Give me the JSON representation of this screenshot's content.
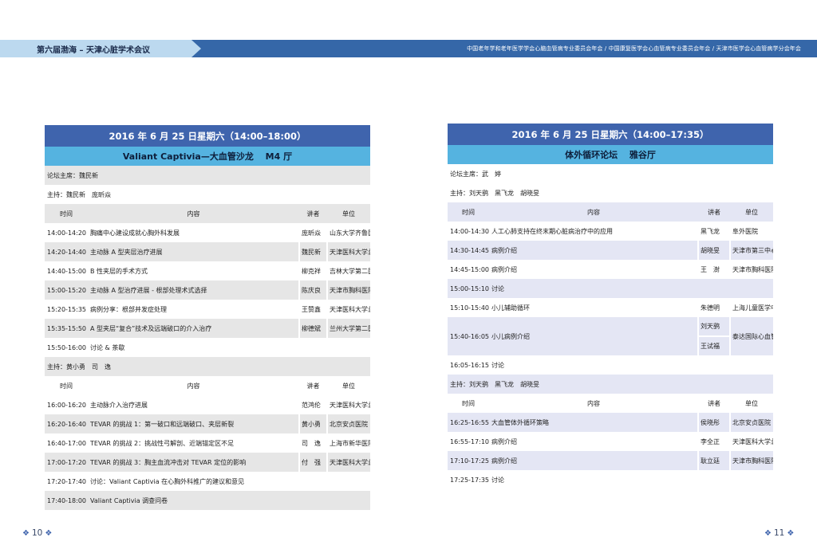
{
  "header": {
    "left_title": "第六届渤海 – 天津心脏学术会议",
    "right_text": "中国老年学和老年医学学会心脑血管病专业委员会年会 / 中国康复医学会心血管病专业委员会年会 / 天津市医学会心血管病学分会年会"
  },
  "left": {
    "date": "2016 年 6 月 25 日星期六（14:00–18:00）",
    "venue": "Valiant Captivia—大血管沙龙 　M4 厅",
    "forum_chair": "论坛主席：魏民新",
    "chair1": "主持：魏民新　庞昕焱",
    "columns": [
      "时间",
      "内容",
      "讲者",
      "单位"
    ],
    "rows1": [
      {
        "time": "14:00-14:20",
        "content": "胸痛中心建设成就心胸外科发展",
        "speaker": "庞昕焱",
        "unit": "山东大学齐鲁医院"
      },
      {
        "time": "14:20-14:40",
        "content": "主动脉 A 型夹层治疗进展",
        "speaker": "魏民新",
        "unit": "天津医科大学总医院"
      },
      {
        "time": "14:40-15:00",
        "content": "B 性夹层的手术方式",
        "speaker": "柳克祥",
        "unit": "吉林大学第二医院"
      },
      {
        "time": "15:00-15:20",
        "content": "主动脉 A 型治疗进展 - 根部处理术式选择",
        "speaker": "陈庆良",
        "unit": "天津市胸科医院"
      },
      {
        "time": "15:20-15:35",
        "content": "病例分享：根部并发症处理",
        "speaker": "王赞鑫",
        "unit": "天津医科大学总医院"
      },
      {
        "time": "15:35-15:50",
        "content": "A 型夹层“复合”技术及远端破口的介入治疗",
        "speaker": "柳德斌",
        "unit": "兰州大学第二医院"
      },
      {
        "time": "15:50-16:00",
        "content": "讨论 & 茶歇",
        "speaker": "",
        "unit": ""
      }
    ],
    "chair2": "主持：黄小勇　司　逸",
    "rows2": [
      {
        "time": "16:00-16:20",
        "content": "主动脉介入治疗进展",
        "speaker": "范鸿伦",
        "unit": "天津医科大学总医院"
      },
      {
        "time": "16:20-16:40",
        "content": "TEVAR 的挑战 1：第一破口和远端破口、夹层新裂",
        "speaker": "黄小勇",
        "unit": "北京安贞医院"
      },
      {
        "time": "16:40-17:00",
        "content": "TEVAR 的挑战 2：挑战性弓解剖、近端锚定区不足",
        "speaker": "司　逸",
        "unit": "上海市新华医院"
      },
      {
        "time": "17:00-17:20",
        "content": "TEVAR 的挑战 3：胸主血流冲击对 TEVAR 定位的影响",
        "speaker": "付　强",
        "unit": "天津医科大学总医院"
      },
      {
        "time": "17:20-17:40",
        "content": "讨论：Valiant Captivia 在心胸外科推广的建议和意见",
        "speaker": "",
        "unit": ""
      },
      {
        "time": "17:40-18:00",
        "content": "Valiant Captivia 调查问卷",
        "speaker": "",
        "unit": ""
      }
    ]
  },
  "right": {
    "date": "2016 年 6 月 25 日星期六（14:00–17:35）",
    "venue": "体外循环论坛 　雅谷厅",
    "forum_chair": "论坛主席：武　婷",
    "chair1": "主持：刘天鹞　黑飞龙　胡晓旻",
    "columns": [
      "时间",
      "内容",
      "讲者",
      "单位"
    ],
    "rows1": [
      {
        "time": "14:00-14:30",
        "content": "人工心肺支持在终末期心脏病治疗中的应用",
        "speaker": "黑飞龙",
        "unit": "阜外医院"
      },
      {
        "time": "14:30-14:45",
        "content": "病例介绍",
        "speaker": "胡晓旻",
        "unit": "天津市第三中心医院"
      },
      {
        "time": "14:45-15:00",
        "content": "病例介绍",
        "speaker": "王　澍",
        "unit": "天津市胸科医院"
      },
      {
        "time": "15:00-15:10",
        "content": "讨论",
        "speaker": "",
        "unit": ""
      },
      {
        "time": "15:10-15:40",
        "content": "小儿辅助循环",
        "speaker": "朱德明",
        "unit": "上海儿童医学中心"
      },
      {
        "time": "15:40-16:05",
        "content": "小儿病例介绍",
        "speaker": "刘天鹞",
        "speaker2": "王试福",
        "unit": "泰达国际心血管病医院"
      },
      {
        "time": "16:05-16:15",
        "content": "讨论",
        "speaker": "",
        "unit": ""
      }
    ],
    "chair2": "主持：刘天鹞　黑飞龙　胡晓旻",
    "rows2": [
      {
        "time": "16:25-16:55",
        "content": "大血管体外循环策略",
        "speaker": "侯晓彤",
        "unit": "北京安贞医院"
      },
      {
        "time": "16:55-17:10",
        "content": "病例介绍",
        "speaker": "李全正",
        "unit": "天津医科大学总医院"
      },
      {
        "time": "17:10-17:25",
        "content": "病例介绍",
        "speaker": "耿立廷",
        "unit": "天津市胸科医院"
      },
      {
        "time": "17:25-17:35",
        "content": "讨论",
        "speaker": "",
        "unit": ""
      }
    ]
  },
  "footer": {
    "left_page": "10",
    "right_page": "11"
  },
  "colors": {
    "title_bar": "#3f64ad",
    "venue_bar": "#55b3e0",
    "header_bar": "#3567a8",
    "header_left": "#bcd9ef",
    "row_gray": "#e6e6e6",
    "row_lavender": "#e4e6f4"
  }
}
